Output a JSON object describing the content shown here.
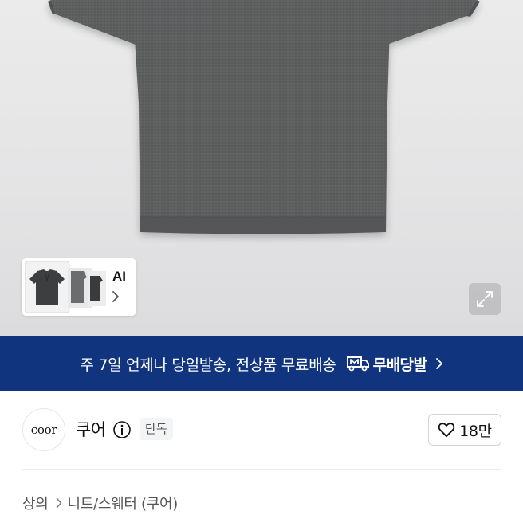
{
  "product_image": {
    "thumbnail_icon": "shirt-thumbnails",
    "ai_label": "AI",
    "expand_icon": "expand-icon"
  },
  "banner": {
    "text": "주 7일 언제나 당일발송, 전상품 무료배송",
    "brand": "무배당발",
    "background": "#10347e",
    "icon": "truck-m-icon"
  },
  "shop": {
    "logo_text": "coor",
    "name": "쿠어",
    "badge": "단독",
    "likes": "18만"
  },
  "breadcrumb": {
    "items": [
      "상의",
      "니트/스웨터 (쿠어)"
    ]
  }
}
